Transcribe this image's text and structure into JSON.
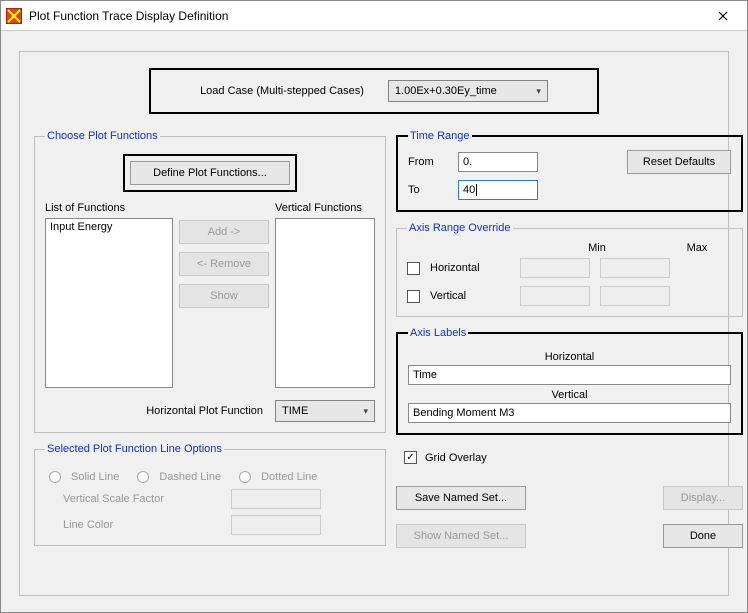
{
  "window": {
    "title": "Plot Function Trace Display Definition"
  },
  "loadcase": {
    "label": "Load Case (Multi-stepped Cases)",
    "value": "1.00Ex+0.30Ey_time"
  },
  "choose_plot_functions": {
    "legend": "Choose Plot Functions",
    "define_button": "Define Plot Functions...",
    "list_label": "List of Functions",
    "list_items": [
      "Input Energy"
    ],
    "vertical_label": "Vertical Functions",
    "add_button": "Add ->",
    "remove_button": "<- Remove",
    "show_button": "Show",
    "horizontal_label": "Horizontal Plot Function",
    "horizontal_value": "TIME"
  },
  "selected_line_options": {
    "legend": "Selected Plot Function Line Options",
    "solid": "Solid Line",
    "dashed": "Dashed Line",
    "dotted": "Dotted Line",
    "vsf": "Vertical  Scale Factor",
    "line_color": "Line Color"
  },
  "time_range": {
    "legend": "Time Range",
    "from_label": "From",
    "from_value": "0.",
    "to_label": "To",
    "to_value": "40",
    "reset": "Reset Defaults"
  },
  "axis_range": {
    "legend": "Axis Range Override",
    "min": "Min",
    "max": "Max",
    "horizontal": "Horizontal",
    "vertical": "Vertical"
  },
  "axis_labels": {
    "legend": "Axis Labels",
    "h_header": "Horizontal",
    "h_value": "Time",
    "v_header": "Vertical",
    "v_value": "Bending Moment M3"
  },
  "grid_overlay": "Grid Overlay",
  "buttons": {
    "save_named": "Save Named Set...",
    "show_named": "Show Named Set...",
    "display": "Display...",
    "done": "Done"
  }
}
